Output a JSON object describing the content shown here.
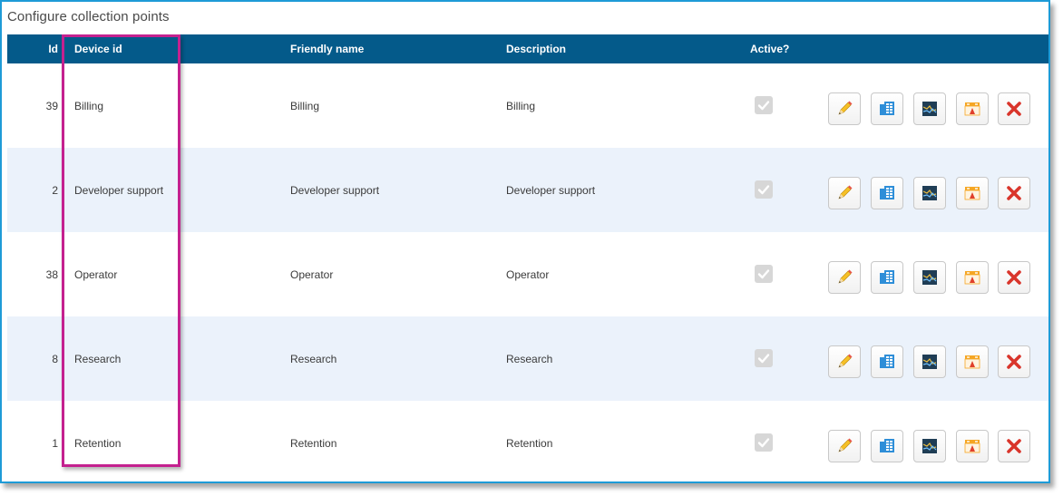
{
  "page": {
    "title": "Configure collection points"
  },
  "table": {
    "headers": {
      "id": "Id",
      "device_id": "Device id",
      "friendly_name": "Friendly name",
      "description": "Description",
      "active": "Active?"
    },
    "rows": [
      {
        "id": "39",
        "device_id": "Billing",
        "friendly_name": "Billing",
        "description": "Billing",
        "active": true
      },
      {
        "id": "2",
        "device_id": "Developer support",
        "friendly_name": "Developer support",
        "description": "Developer support",
        "active": true
      },
      {
        "id": "38",
        "device_id": "Operator",
        "friendly_name": "Operator",
        "description": "Operator",
        "active": true
      },
      {
        "id": "8",
        "device_id": "Research",
        "friendly_name": "Research",
        "description": "Research",
        "active": true
      },
      {
        "id": "1",
        "device_id": "Retention",
        "friendly_name": "Retention",
        "description": "Retention",
        "active": true
      }
    ],
    "row_actions": [
      "pencil-icon",
      "columns-icon",
      "chart-icon",
      "report-icon",
      "delete-x-icon"
    ]
  },
  "colors": {
    "header_bg": "#045a8a",
    "alt_row_bg": "#ebf2fb",
    "highlight_border": "#c4218f",
    "frame_border": "#1e9bd7",
    "delete_red": "#d9352b"
  }
}
